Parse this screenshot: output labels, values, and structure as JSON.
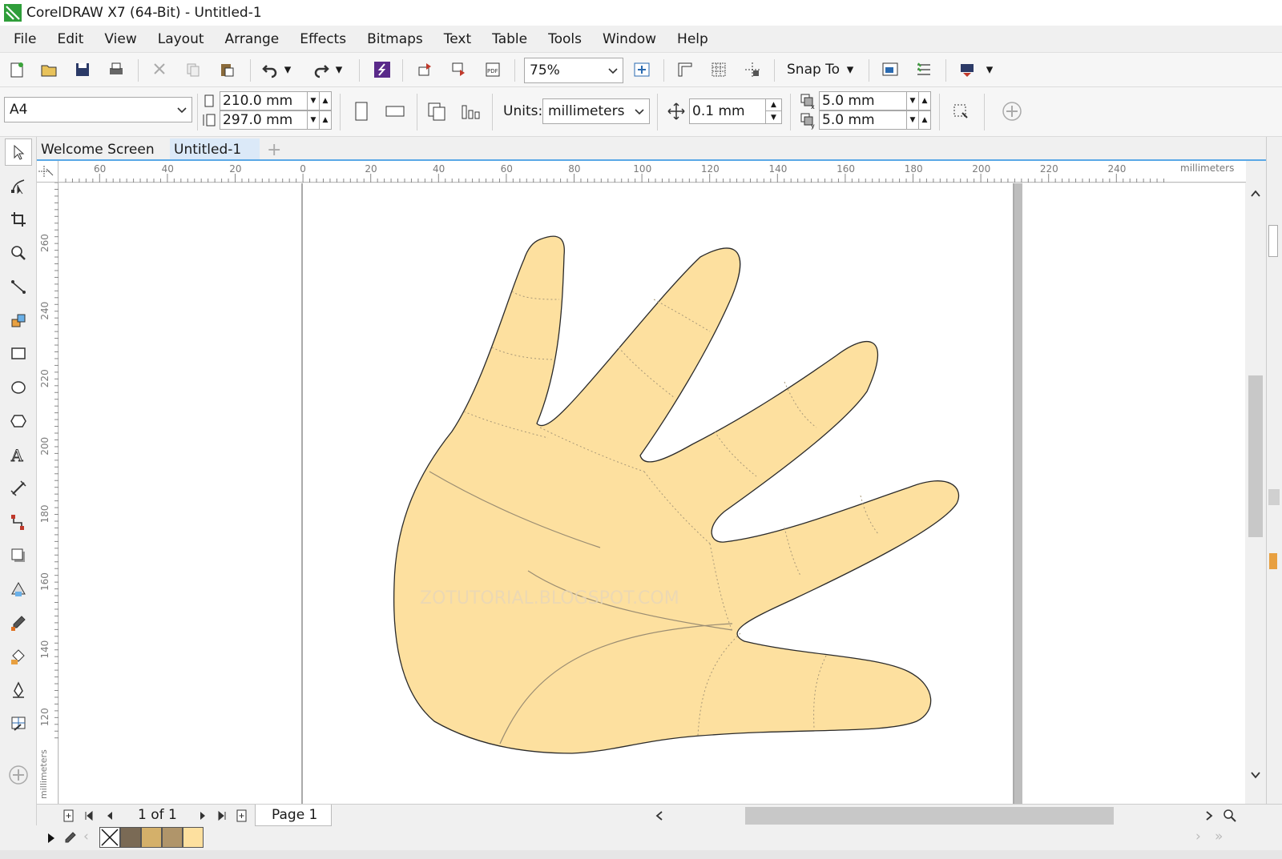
{
  "window": {
    "title": "CorelDRAW X7 (64-Bit) - Untitled-1"
  },
  "menu": [
    "File",
    "Edit",
    "View",
    "Layout",
    "Arrange",
    "Effects",
    "Bitmaps",
    "Text",
    "Table",
    "Tools",
    "Window",
    "Help"
  ],
  "toolbar": {
    "zoom": "75%",
    "snap_to": "Snap To"
  },
  "property_bar": {
    "page_size": "A4",
    "width": "210.0 mm",
    "height": "297.0 mm",
    "units_label": "Units:",
    "units": "millimeters",
    "nudge": "0.1 mm",
    "dup_x": "5.0 mm",
    "dup_y": "5.0 mm"
  },
  "doc_tabs": [
    "Welcome Screen",
    "Untitled-1"
  ],
  "ruler": {
    "unit_label": "millimeters",
    "h_ticks": [
      "60",
      "40",
      "20",
      "0",
      "20",
      "40",
      "60",
      "80",
      "100",
      "120",
      "140",
      "160",
      "180",
      "200",
      "220",
      "240"
    ],
    "v_ticks": [
      "260",
      "240",
      "220",
      "200",
      "180",
      "160",
      "140",
      "120"
    ],
    "v_unit_label": "millimeters"
  },
  "canvas": {
    "watermark": "ZOTUTORIAL.BLOGSPOT.COM",
    "hand_fill": "#fde09f",
    "hand_outline": "#2a2a2a"
  },
  "status": {
    "page_count": "1 of 1",
    "page_tab": "Page 1"
  },
  "palette": {
    "colors": [
      "#7a6a55",
      "#d4b06a",
      "#b0956a",
      "#fde09f"
    ]
  }
}
